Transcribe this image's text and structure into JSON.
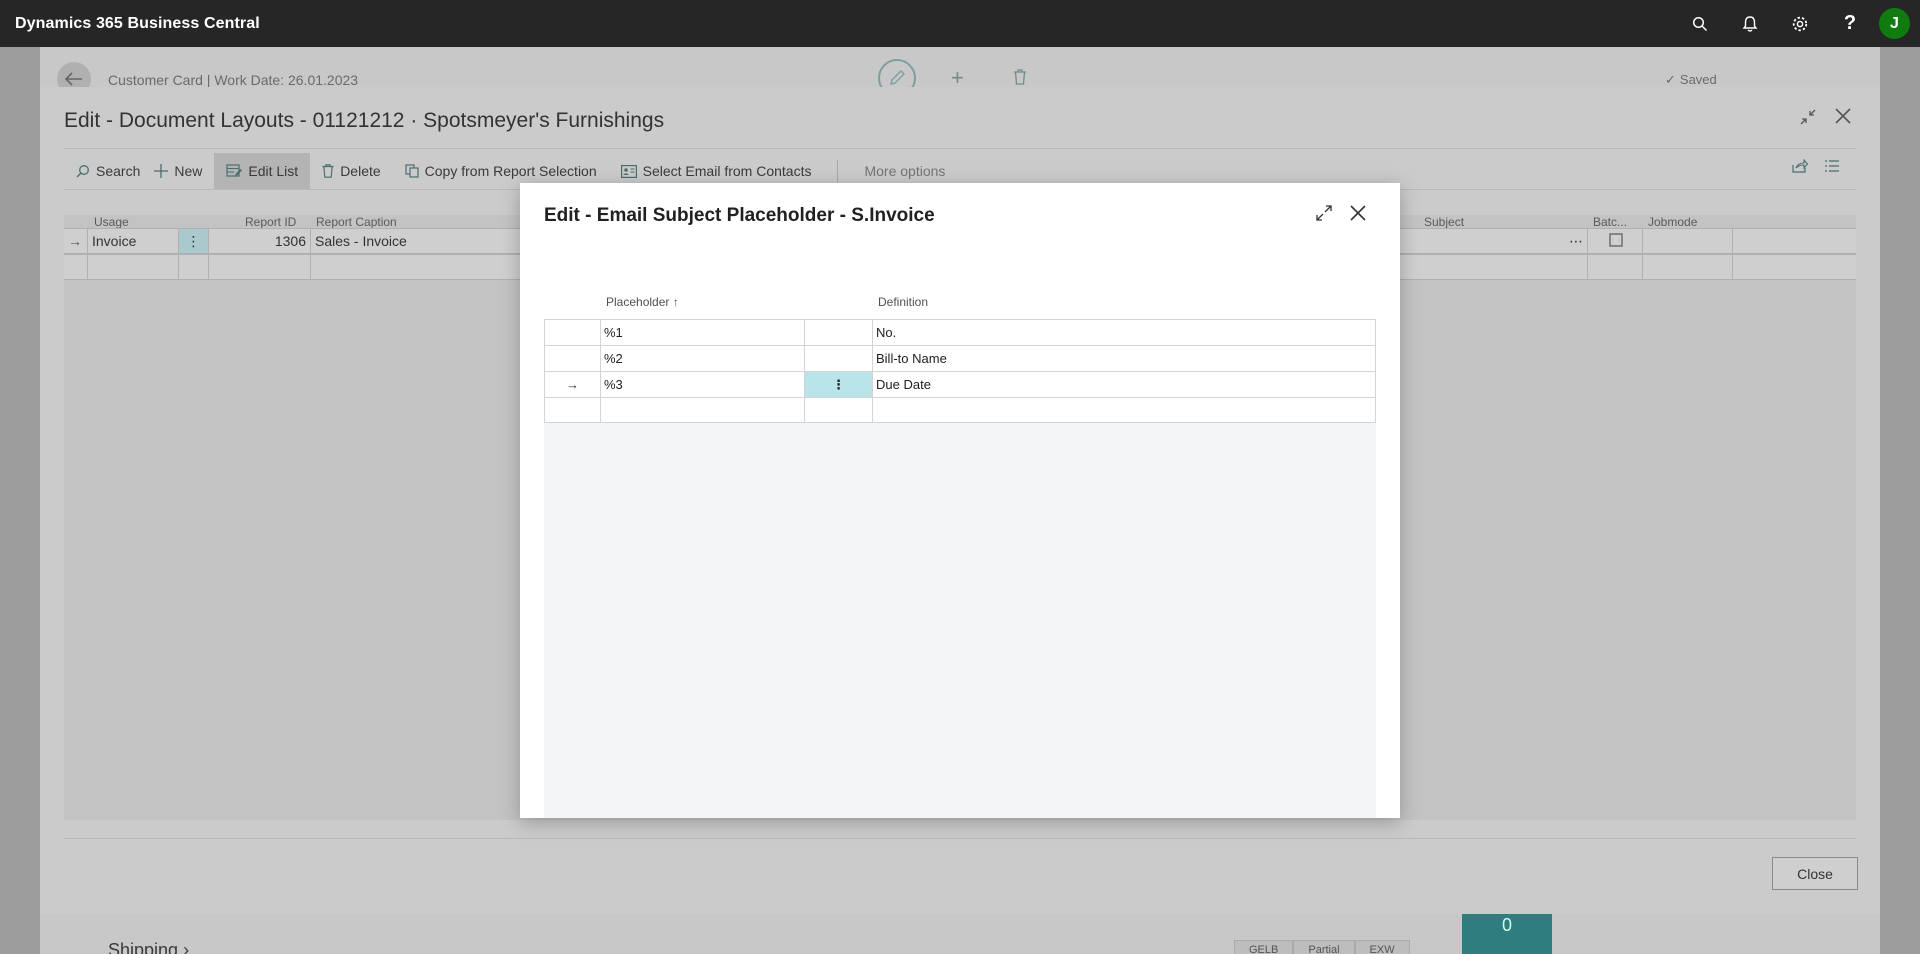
{
  "app": {
    "title": "Dynamics 365 Business Central",
    "avatar_initial": "J"
  },
  "background_page": {
    "breadcrumb": "Customer Card | Work Date: 26.01.2023",
    "saved_label": "Saved",
    "section_shipping": "Shipping",
    "pills": [
      "GELB",
      "Partial",
      "EXW"
    ],
    "tile_text": "0"
  },
  "document_layouts": {
    "title": "Edit - Document Layouts - 01121212 · Spotsmeyer's Furnishings",
    "toolbar": {
      "search": "Search",
      "new": "New",
      "edit_list": "Edit List",
      "delete": "Delete",
      "copy_from_report": "Copy from Report Selection",
      "select_email": "Select Email from Contacts",
      "more_options": "More options"
    },
    "columns": {
      "usage": "Usage",
      "report_id": "Report ID",
      "report_caption": "Report Caption",
      "subject": "Subject",
      "batch": "Batc...",
      "jobmode": "Jobmode"
    },
    "rows": [
      {
        "usage": "Invoice",
        "report_id": "1306",
        "report_caption": "Sales - Invoice"
      }
    ],
    "close_button": "Close"
  },
  "email_placeholder_dialog": {
    "title": "Edit - Email Subject Placeholder - S.Invoice",
    "columns": {
      "placeholder": "Placeholder",
      "definition": "Definition"
    },
    "rows": [
      {
        "placeholder": "%1",
        "definition": "No."
      },
      {
        "placeholder": "%2",
        "definition": "Bill-to Name"
      },
      {
        "placeholder": "%3",
        "definition": "Due Date"
      },
      {
        "placeholder": "",
        "definition": ""
      }
    ]
  },
  "colors": {
    "appbar": "#262626",
    "avatar": "#107c10",
    "selected_cell": "#b8e4ea",
    "accent_teal": "#4a6e6e"
  }
}
